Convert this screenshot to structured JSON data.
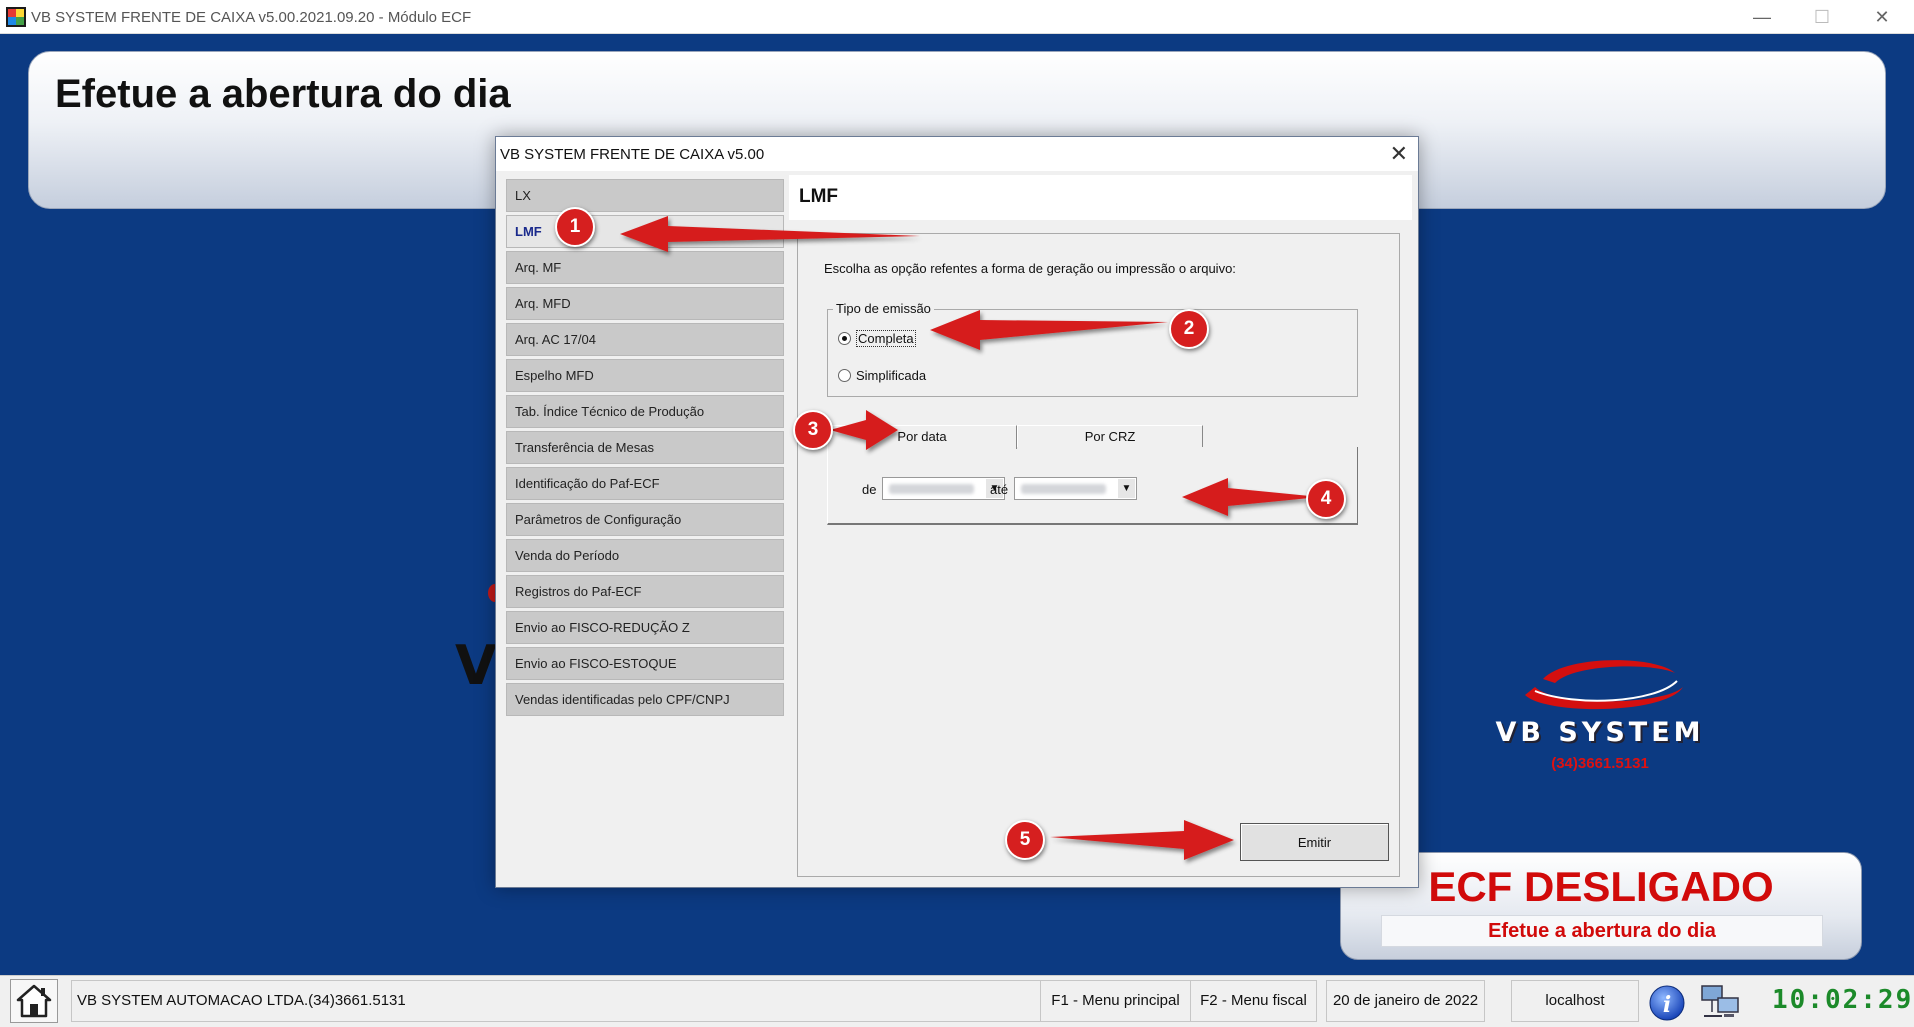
{
  "window": {
    "title": "VB SYSTEM FRENTE DE CAIXA v5.00.2021.09.20 - Módulo ECF",
    "minimize": "—",
    "maximize": "☐",
    "close": "✕"
  },
  "header": {
    "title": "Efetue a abertura do dia"
  },
  "logo": {
    "text": "VB SYSTEM",
    "phone": "(34)3661.5131",
    "partial_letter": "V"
  },
  "ecf_status": {
    "title": "ECF DESLIGADO",
    "subtitle": "Efetue a abertura do dia"
  },
  "dialog": {
    "title": "VB SYSTEM FRENTE DE CAIXA v5.00",
    "close": "✕",
    "menu": [
      {
        "label": "LX",
        "active": false
      },
      {
        "label": "LMF",
        "active": true
      },
      {
        "label": "Arq. MF",
        "active": false
      },
      {
        "label": "Arq. MFD",
        "active": false
      },
      {
        "label": "Arq. AC 17/04",
        "active": false
      },
      {
        "label": "Espelho MFD",
        "active": false
      },
      {
        "label": "Tab. Índice Técnico de Produção",
        "active": false
      },
      {
        "label": "Transferência de Mesas",
        "active": false
      },
      {
        "label": "Identificação do Paf-ECF",
        "active": false
      },
      {
        "label": "Parâmetros de Configuração",
        "active": false
      },
      {
        "label": "Venda do Período",
        "active": false
      },
      {
        "label": "Registros do Paf-ECF",
        "active": false
      },
      {
        "label": "Envio ao FISCO-REDUÇÃO Z",
        "active": false
      },
      {
        "label": "Envio ao FISCO-ESTOQUE",
        "active": false
      },
      {
        "label": "Vendas identificadas pelo CPF/CNPJ",
        "active": false
      }
    ],
    "content": {
      "title": "LMF",
      "instructions": "Escolha as opção refentes a forma de geração ou impressão o arquivo:",
      "tipo_emissao": {
        "legend": "Tipo de emissão",
        "options": [
          {
            "label": "Completa",
            "checked": true
          },
          {
            "label": "Simplificada",
            "checked": false
          }
        ]
      },
      "tabs": [
        {
          "label": "Por data",
          "active": true
        },
        {
          "label": "Por CRZ",
          "active": false
        }
      ],
      "date_range": {
        "from_label": "de",
        "to_label": "até",
        "dropdown_arrow": "▼"
      },
      "emit_button": "Emitir"
    }
  },
  "annotations": [
    "1",
    "2",
    "3",
    "4",
    "5"
  ],
  "annotation_color": "#d61f1f",
  "statusbar": {
    "company": "VB SYSTEM AUTOMACAO LTDA.(34)3661.5131",
    "f1": "F1 - Menu principal",
    "f2": "F2 - Menu fiscal",
    "date": "20 de janeiro de 2022",
    "host": "localhost",
    "clock": "10:02:29"
  },
  "colors": {
    "desktop": "#0c3a82",
    "ecf_red": "#d10a0a",
    "clock_green": "#1c8a2a",
    "active_menu_text": "#1a2a8c"
  }
}
